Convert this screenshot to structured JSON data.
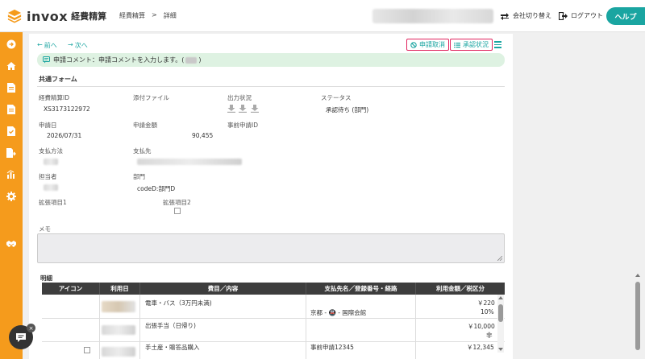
{
  "app": {
    "logo_text": "invox",
    "logo_sub": "経費精算",
    "brand_color": "#f59b1c",
    "accent_color": "#1aa5a1"
  },
  "breadcrumb": {
    "section": "経費精算",
    "separator": ">",
    "page": "詳細"
  },
  "header": {
    "switch_company": "会社切り替え",
    "logout": "ログアウト",
    "help": "ヘルプ"
  },
  "sidebar": {
    "icons": [
      "arrow-right-circle-icon",
      "home-icon",
      "document-icon",
      "document-icon",
      "document-check-icon",
      "document-export-icon",
      "chart-icon",
      "gear-icon",
      "handshake-icon"
    ]
  },
  "nav": {
    "prev": "前へ",
    "next": "次へ"
  },
  "actions": {
    "cancel_request": "申請取消",
    "approval_status": "承認状況"
  },
  "comment": {
    "prefix": "申請コメント：申請コメントを入力します。(",
    "suffix": ")"
  },
  "form": {
    "title": "共通フォーム",
    "expense_id_label": "経費精算ID",
    "expense_id_value": "XS3173122972",
    "attachment_label": "添付ファイル",
    "output_label": "出力状況",
    "status_label": "ステータス",
    "status_value": "承認待ち (部門)",
    "request_date_label": "申請日",
    "request_date_value": "2026/07/31",
    "amount_label": "申請金額",
    "amount_value": "90,455",
    "prior_request_label": "事前申請ID",
    "payment_method_label": "支払方法",
    "payee_label": "支払先",
    "person_label": "担当者",
    "department_label": "部門",
    "department_value": "codeD:部門D",
    "ext1_label": "拡張項目1",
    "ext2_label": "拡張項目2",
    "memo_label": "メモ"
  },
  "table": {
    "title": "明細",
    "headers": [
      "アイコン",
      "利用日",
      "費目／内容",
      "支払先名／登録番号・経路",
      "利用金額／税区分"
    ],
    "rows": [
      {
        "item": "電車・バス（3万円未満)",
        "route": "京都 - 🚇 - 国際会館",
        "amount": "￥220",
        "tax": "10%"
      },
      {
        "item": "出張手当（日帰り)",
        "route": "",
        "amount": "￥10,000",
        "tax": "非"
      },
      {
        "item": "手土産・贈答品購入",
        "route": "事前申請12345",
        "amount": "￥12,345",
        "tax": ""
      }
    ]
  }
}
